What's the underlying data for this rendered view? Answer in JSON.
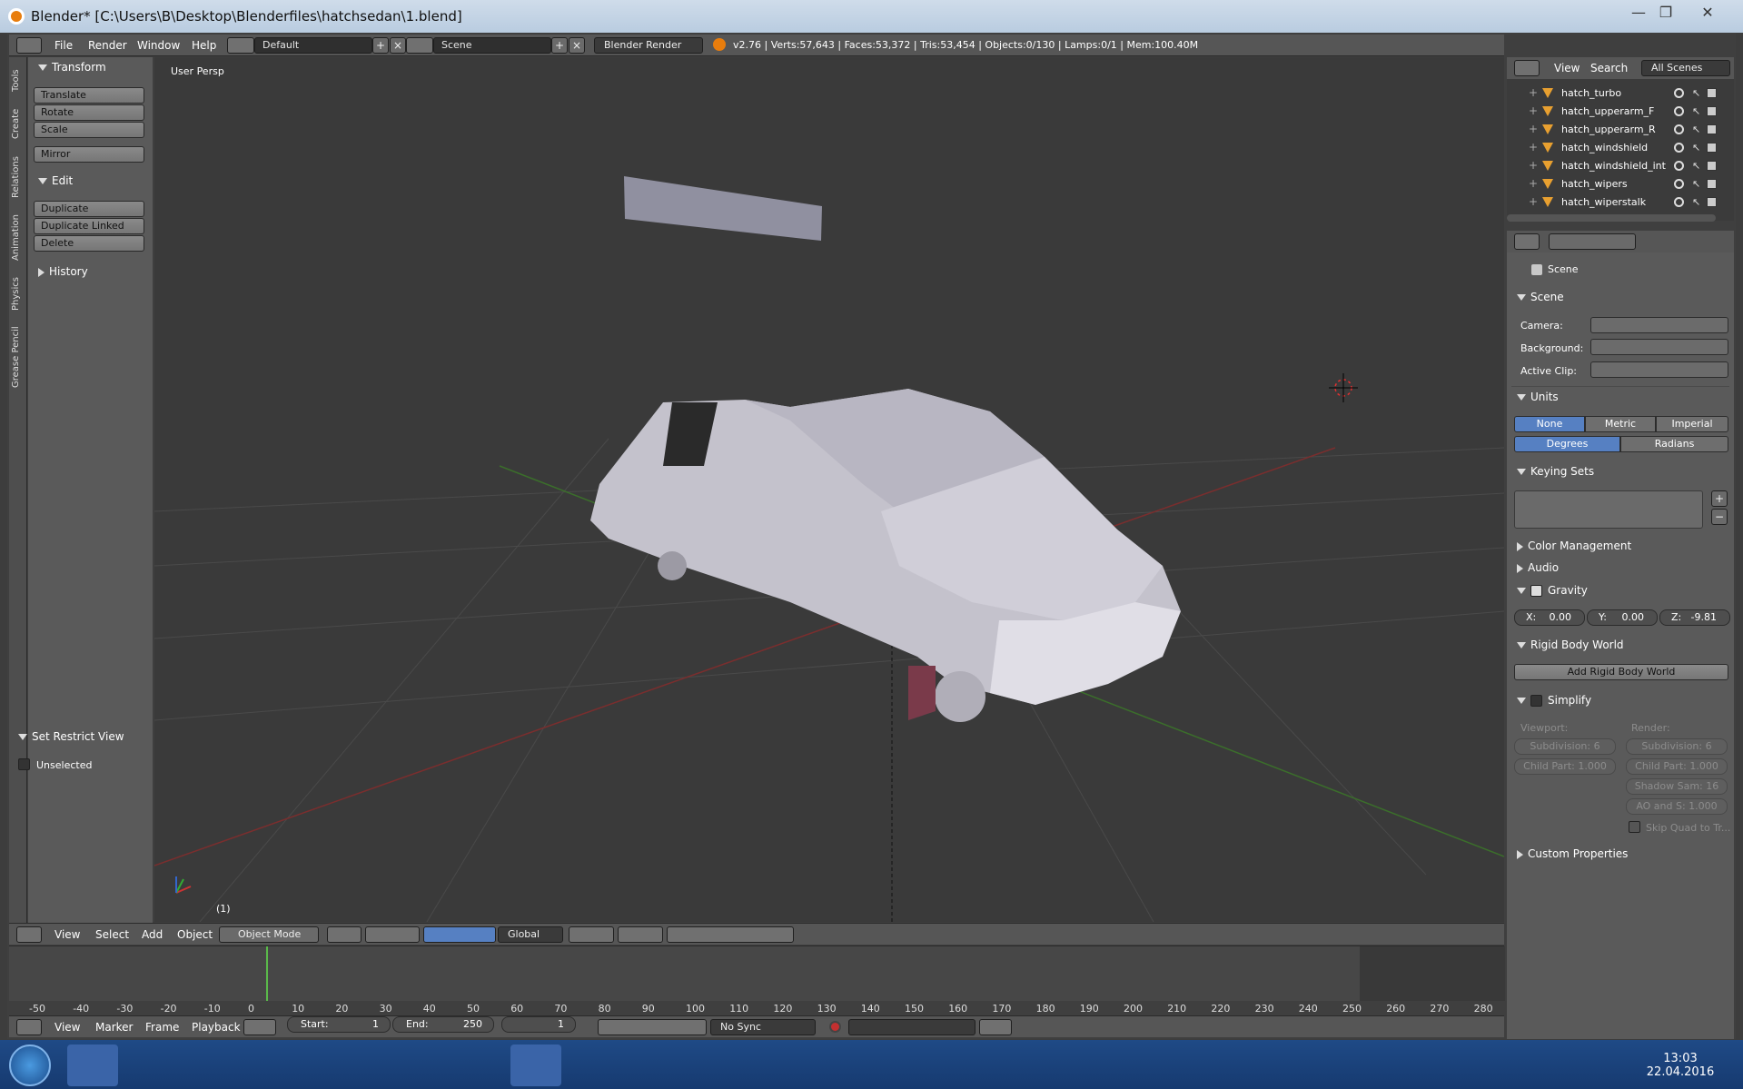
{
  "window": {
    "title": "Blender* [C:\\Users\\B\\Desktop\\Blenderfiles\\hatchsedan\\1.blend]",
    "controls": [
      "—",
      "❐",
      "✕"
    ]
  },
  "info_header": {
    "menus": [
      "File",
      "Render",
      "Window",
      "Help"
    ],
    "layout": "Default",
    "scene": "Scene",
    "render_engine": "Blender Render",
    "stats": "v2.76 | Verts:57,643 | Faces:53,372 | Tris:53,454 | Objects:0/130 | Lamps:0/1 | Mem:100.40M"
  },
  "tool_tabs": [
    "Tools",
    "Create",
    "Relations",
    "Animation",
    "Physics",
    "Grease Pencil"
  ],
  "tools": {
    "transform_header": "Transform",
    "transform_buttons": [
      "Translate",
      "Rotate",
      "Scale"
    ],
    "mirror": "Mirror",
    "edit_header": "Edit",
    "edit_buttons": [
      "Duplicate",
      "Duplicate Linked",
      "Delete"
    ],
    "history_header": "History"
  },
  "restrict_view": {
    "header": "Set Restrict View",
    "option": "Unselected"
  },
  "viewport": {
    "label": "User Persp",
    "frame_indicator": "(1)"
  },
  "viewport_header": {
    "menus": [
      "View",
      "Select",
      "Add",
      "Object"
    ],
    "mode": "Object Mode",
    "orientation": "Global"
  },
  "timeline": {
    "ruler": [
      "-50",
      "-40",
      "-30",
      "-20",
      "-10",
      "0",
      "10",
      "20",
      "30",
      "40",
      "50",
      "60",
      "70",
      "80",
      "90",
      "100",
      "110",
      "120",
      "130",
      "140",
      "150",
      "160",
      "170",
      "180",
      "190",
      "200",
      "210",
      "220",
      "230",
      "240",
      "250",
      "260",
      "270",
      "280"
    ],
    "menus": [
      "View",
      "Marker",
      "Frame",
      "Playback"
    ],
    "start_label": "Start:",
    "start": "1",
    "end_label": "End:",
    "end": "250",
    "current": "1",
    "sync": "No Sync"
  },
  "outliner": {
    "menus": [
      "View",
      "Search"
    ],
    "filter": "All Scenes",
    "items": [
      "hatch_turbo",
      "hatch_upperarm_F",
      "hatch_upperarm_R",
      "hatch_windshield",
      "hatch_windshield_int",
      "hatch_wipers",
      "hatch_wiperstalk"
    ]
  },
  "properties": {
    "breadcrumb": "Scene",
    "scene_header": "Scene",
    "camera_label": "Camera:",
    "background_label": "Background:",
    "active_clip_label": "Active Clip:",
    "units_header": "Units",
    "unit_systems": [
      "None",
      "Metric",
      "Imperial"
    ],
    "rotation_units": [
      "Degrees",
      "Radians"
    ],
    "keying_sets_header": "Keying Sets",
    "color_management": "Color Management",
    "audio": "Audio",
    "gravity_header": "Gravity",
    "gravity": {
      "x_label": "X:",
      "x": "0.00",
      "y_label": "Y:",
      "y": "0.00",
      "z_label": "Z:",
      "z": "-9.81"
    },
    "rigid_body_header": "Rigid Body World",
    "rigid_body_button": "Add Rigid Body World",
    "simplify_header": "Simplify",
    "viewport_label": "Viewport:",
    "render_label": "Render:",
    "simplify_viewport": [
      "Subdivision: 6",
      "Child Part: 1.000"
    ],
    "simplify_render": [
      "Subdivision: 6",
      "Child Part: 1.000",
      "Shadow Sam: 16",
      "AO and S: 1.000"
    ],
    "skip_quad": "Skip Quad to Tr...",
    "custom_props": "Custom Properties"
  },
  "taskbar": {
    "time": "13:03",
    "date": "22.04.2016"
  },
  "colors": {
    "accent_blue": "#5680c2",
    "object_orange": "#e8a030",
    "viewport_bg": "#3a3a3a"
  }
}
